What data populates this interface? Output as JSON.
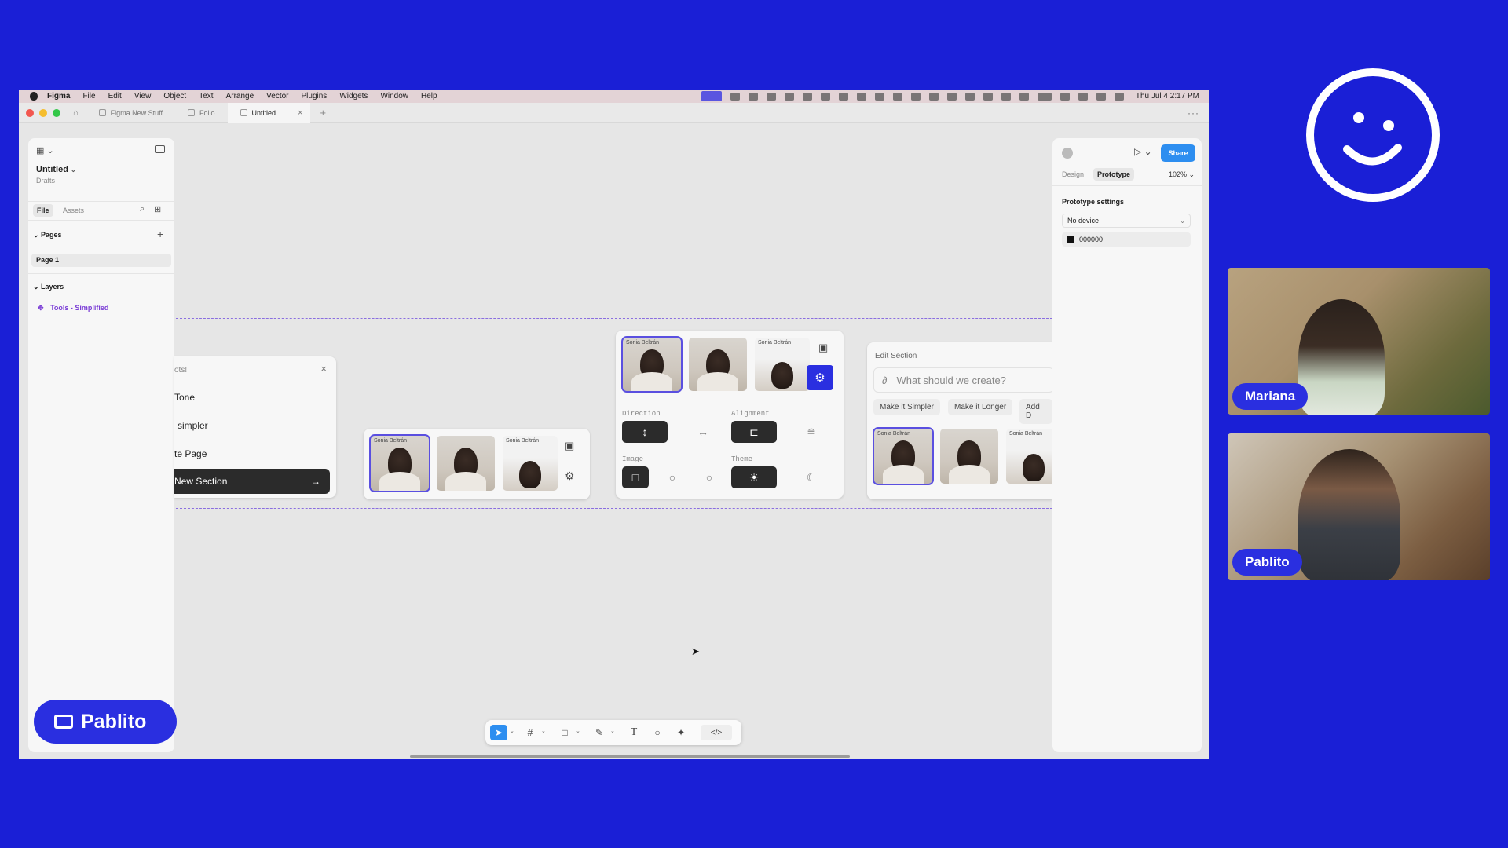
{
  "mac_menu": {
    "items": [
      "Figma",
      "File",
      "Edit",
      "View",
      "Object",
      "Text",
      "Arrange",
      "Vector",
      "Plugins",
      "Widgets",
      "Window",
      "Help"
    ],
    "clock": "Thu Jul 4  2:17 PM"
  },
  "tabs": [
    {
      "label": "Figma New Stuff"
    },
    {
      "label": "Folio"
    },
    {
      "label": "Untitled"
    }
  ],
  "left_panel": {
    "file_name": "Untitled",
    "location": "Drafts",
    "tab_file": "File",
    "tab_assets": "Assets",
    "pages_header": "Pages",
    "page_1": "Page 1",
    "layers_header": "Layers",
    "layer_1": "Tools - Simplified"
  },
  "right_panel": {
    "share": "Share",
    "tab_design": "Design",
    "tab_prototype": "Prototype",
    "zoom": "102%",
    "section_title": "Prototype settings",
    "device": "No device",
    "bg_color_hex": "000000"
  },
  "canvas": {
    "menu_card": {
      "title_fragment": "ots!",
      "item_1": "Tone",
      "item_2": "simpler",
      "item_3": "te Page",
      "item_4": "New Section"
    },
    "thumb_label": "Sonia Beltrán",
    "settings_card": {
      "direction": "Direction",
      "alignment": "Alignment",
      "image": "Image",
      "theme": "Theme"
    },
    "edit_card": {
      "title": "Edit Section",
      "placeholder": "What should we create?",
      "chip_1": "Make it Simpler",
      "chip_2": "Make it Longer",
      "chip_3": "Add D"
    }
  },
  "participants": {
    "cam_1": "Mariana",
    "cam_2": "Pablito",
    "presenter": "Pablito"
  },
  "colors": {
    "background": "#1a1fd6",
    "accent": "#2a2fe0",
    "figma_blue": "#2d8ef0"
  }
}
